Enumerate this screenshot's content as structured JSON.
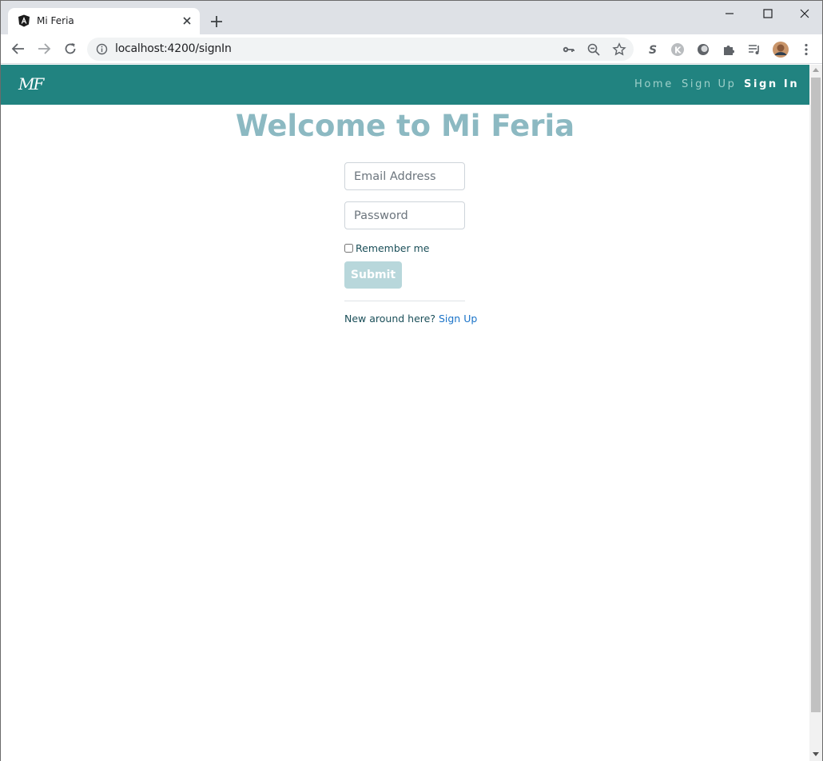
{
  "browser": {
    "tab_title": "Mi Feria",
    "url": "localhost:4200/signIn"
  },
  "navbar": {
    "brand": "MF",
    "links": [
      {
        "label": "Home"
      },
      {
        "label": "Sign Up"
      },
      {
        "label": "Sign In"
      }
    ]
  },
  "main": {
    "title": "Welcome to Mi Feria",
    "email_placeholder": "Email Address",
    "password_placeholder": "Password",
    "remember_label": "Remember me",
    "submit_label": "Submit",
    "signup_prompt": "New around here?",
    "signup_link": "Sign Up"
  },
  "colors": {
    "navbar": "#218380",
    "title": "#8cb9c2",
    "submit": "#b8d7db",
    "link": "#1a73c8"
  },
  "icons": {
    "tab_favicon": "angular-logo-icon",
    "tab_close": "close-icon",
    "new_tab": "plus-icon",
    "back": "back-arrow-icon",
    "forward": "forward-arrow-icon",
    "reload": "reload-icon",
    "info": "info-icon",
    "key": "key-icon",
    "zoom": "zoom-out-icon",
    "bookmark": "star-icon",
    "extensions": "puzzle-icon",
    "reading_list": "reading-list-icon",
    "menu": "kebab-menu-icon"
  }
}
